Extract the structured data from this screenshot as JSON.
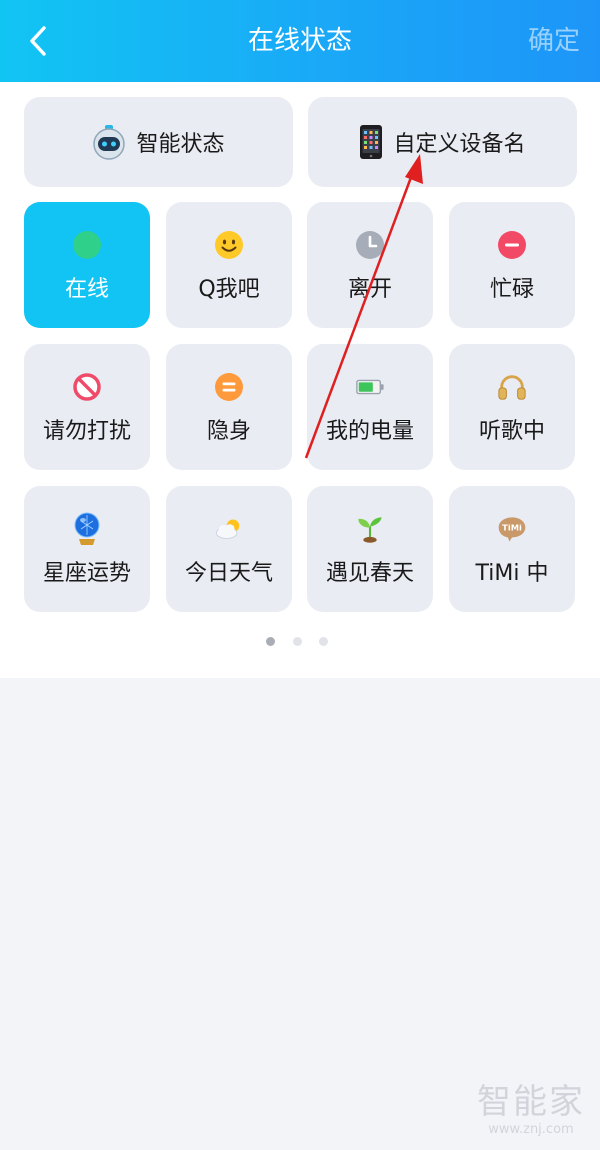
{
  "header": {
    "title": "在线状态",
    "confirm_label": "确定"
  },
  "wide_cards": [
    {
      "label": "智能状态",
      "icon": "robot-icon"
    },
    {
      "label": "自定义设备名",
      "icon": "phone-icon"
    }
  ],
  "status_tiles": [
    {
      "label": "在线",
      "icon": "online-dot-icon",
      "selected": true
    },
    {
      "label": "Q我吧",
      "icon": "smile-icon"
    },
    {
      "label": "离开",
      "icon": "clock-icon"
    },
    {
      "label": "忙碌",
      "icon": "busy-icon"
    },
    {
      "label": "请勿打扰",
      "icon": "no-disturb-icon"
    },
    {
      "label": "隐身",
      "icon": "invisible-icon"
    },
    {
      "label": "我的电量",
      "icon": "battery-icon"
    },
    {
      "label": "听歌中",
      "icon": "headphones-icon"
    },
    {
      "label": "星座运势",
      "icon": "crystal-ball-icon"
    },
    {
      "label": "今日天气",
      "icon": "weather-icon"
    },
    {
      "label": "遇见春天",
      "icon": "sprout-icon"
    },
    {
      "label": "TiMi 中",
      "icon": "timi-icon",
      "icon_text": "TiMi"
    }
  ],
  "pagination": {
    "current": 1,
    "total": 3
  },
  "watermark": {
    "main": "智能家",
    "sub": "www.znj.com"
  },
  "colors": {
    "header_gradient_start": "#11c5f3",
    "header_gradient_end": "#1d95f8",
    "selected_tile": "#12c4f3",
    "tile_bg": "#e9ecf3",
    "annotation_arrow": "#e02020"
  }
}
